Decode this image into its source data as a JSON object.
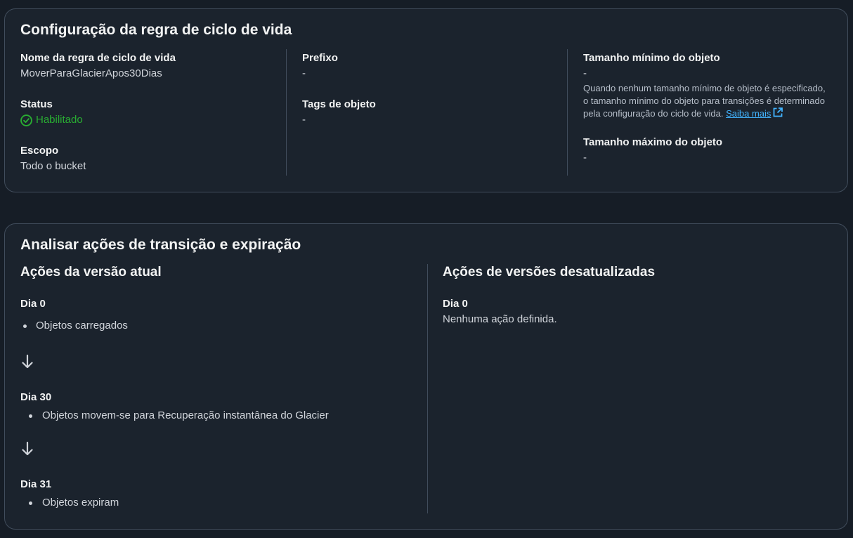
{
  "config": {
    "title": "Configuração da regra de ciclo de vida",
    "rule_name_label": "Nome da regra de ciclo de vida",
    "rule_name": "MoverParaGlacierApos30Dias",
    "status_label": "Status",
    "status": "Habilitado",
    "scope_label": "Escopo",
    "scope": "Todo o bucket",
    "prefix_label": "Prefixo",
    "prefix": "-",
    "tags_label": "Tags de objeto",
    "tags": "-",
    "min_size_label": "Tamanho mínimo do objeto",
    "min_size": "-",
    "min_size_hint": "Quando nenhum tamanho mínimo de objeto é especificado, o tamanho mínimo do objeto para transições é determinado pela configuração do ciclo de vida.",
    "learn_more": "Saiba mais",
    "max_size_label": "Tamanho máximo do objeto",
    "max_size": "-"
  },
  "review": {
    "title": "Analisar ações de transição e expiração",
    "current": {
      "title": "Ações da versão atual",
      "steps": [
        {
          "day": "Dia 0",
          "action": "Objetos carregados"
        },
        {
          "day": "Dia 30",
          "action": "Objetos movem-se para Recuperação instantânea do Glacier"
        },
        {
          "day": "Dia 31",
          "action": "Objetos expiram"
        }
      ]
    },
    "noncurrent": {
      "title": "Ações de versões desatualizadas",
      "day": "Dia 0",
      "text": "Nenhuma ação definida."
    }
  },
  "colors": {
    "background": "#161d26",
    "card": "#1b232d",
    "border": "#414d5c",
    "success": "#29ad32",
    "link": "#42b4ff"
  },
  "icons": {
    "status": "check-circle-icon",
    "external": "external-link-icon",
    "arrow": "arrow-down-icon"
  }
}
